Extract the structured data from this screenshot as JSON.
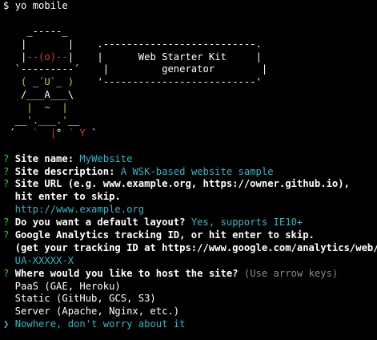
{
  "terminal": {
    "prompt_symbol": "$",
    "command": "yo mobile"
  },
  "art": {
    "lines": [
      [
        {
          "t": "    _-----_",
          "c": "w"
        }
      ],
      [
        {
          "t": "   |       |    .--------------------------.",
          "c": "w"
        }
      ],
      [
        {
          "t": "   |",
          "c": "w"
        },
        {
          "t": "--(o)--",
          "c": "r"
        },
        {
          "t": "|    |      Web Starter Kit     |",
          "c": "w"
        }
      ],
      [
        {
          "t": "  `---------´    |         generator        |",
          "c": "w"
        }
      ],
      [
        {
          "t": "   ",
          "c": "w"
        },
        {
          "t": "( ",
          "c": "y"
        },
        {
          "t": "_",
          "c": "w"
        },
        {
          "t": "´U`",
          "c": "y"
        },
        {
          "t": "_ ",
          "c": "w"
        },
        {
          "t": ")",
          "c": "y"
        },
        {
          "t": "    '--------------------------'",
          "c": "w"
        }
      ],
      [
        {
          "t": "   /___A___\\",
          "c": "w"
        }
      ],
      [
        {
          "t": "    ",
          "c": "w"
        },
        {
          "t": "|  ~  |",
          "c": "y"
        }
      ],
      [
        {
          "t": "  __",
          "c": "w"
        },
        {
          "t": "'.___.'",
          "c": "y"
        },
        {
          "t": "__",
          "c": "w"
        }
      ],
      [
        {
          "t": " ´   ",
          "c": "w"
        },
        {
          "t": "`  |",
          "c": "r"
        },
        {
          "t": "° ",
          "c": "w"
        },
        {
          "t": "´ Y",
          "c": "r"
        },
        {
          "t": " `",
          "c": "w"
        }
      ]
    ]
  },
  "questions": [
    {
      "question": "Site name:",
      "answer": "MyWebsite"
    },
    {
      "question": "Site description:",
      "answer": "A WSK-based website sample"
    },
    {
      "question": "Site URL (e.g. www.example.org, https://owner.github.io),",
      "question_cont": "  hit enter to skip.",
      "answer": "  http://www.example.org"
    },
    {
      "question": "Do you want a default layout?",
      "answer": "Yes, supports IE10+"
    },
    {
      "question": "Google Analytics tracking ID, or hit enter to skip.",
      "question_cont": "  (get your tracking ID at https://www.google.com/analytics/web/)",
      "answer": "  UA-XXXXX-X"
    }
  ],
  "hosting": {
    "question": "Where would you like to host the site?",
    "hint": "(Use arrow keys)",
    "options": [
      "  PaaS (GAE, Heroku)",
      "  Static (GitHub, GCS, S3)",
      "  Server (Apache, Nginx, etc.)"
    ],
    "selected_marker": "❯",
    "selected_option": "Nowhere, don't worry about it"
  },
  "q_marker": "?",
  "colors": {
    "background": "#000000",
    "text": "#ffffff",
    "prompt_green": "#29d329",
    "answer_cyan": "#2fb8c8",
    "eye_red": "#d9382f",
    "face_yellow": "#d8c634",
    "hint_gray": "#8a8a8a"
  }
}
